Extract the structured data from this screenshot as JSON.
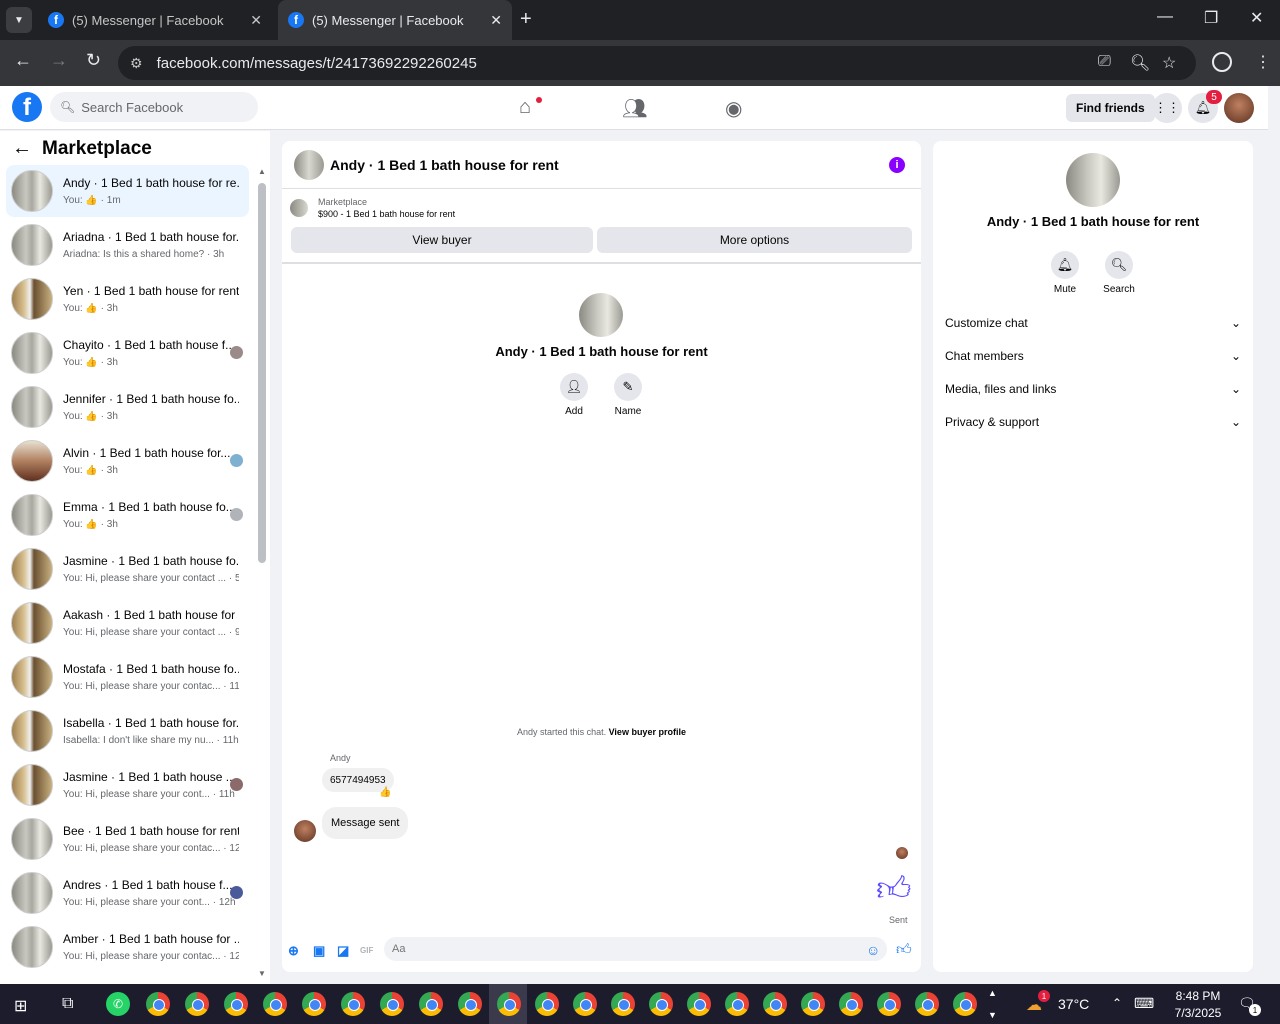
{
  "browser": {
    "tabs": [
      {
        "title": "(5) Messenger | Facebook",
        "active": false
      },
      {
        "title": "(5) Messenger | Facebook",
        "active": true
      }
    ],
    "url": "facebook.com/messages/t/24173692292260245"
  },
  "fb_nav": {
    "search_placeholder": "Search Facebook",
    "find_friends": "Find friends",
    "notification_count": "5"
  },
  "sidebar": {
    "title": "Marketplace",
    "conversations": [
      {
        "name": "Andy · 1 Bed 1 bath house for re...",
        "snippet": "You: 👍 · 1m"
      },
      {
        "name": "Ariadna · 1 Bed 1 bath house for...",
        "snippet": "Ariadna: Is this a shared home? · 3h"
      },
      {
        "name": "Yen · 1 Bed 1 bath house for rent",
        "snippet": "You: 👍 · 3h"
      },
      {
        "name": "Chayito · 1 Bed 1 bath house f...",
        "snippet": "You: 👍 · 3h"
      },
      {
        "name": "Jennifer · 1 Bed 1 bath house fo...",
        "snippet": "You: 👍 · 3h"
      },
      {
        "name": "Alvin · 1 Bed 1 bath house for...",
        "snippet": "You: 👍 · 3h"
      },
      {
        "name": "Emma · 1 Bed 1 bath house fo...",
        "snippet": "You: 👍 · 3h"
      },
      {
        "name": "Jasmine · 1 Bed 1 bath house fo...",
        "snippet": "You: Hi, please share your contact ... · 5h"
      },
      {
        "name": "Aakash · 1 Bed 1 bath house for ...",
        "snippet": "You: Hi, please share your contact ... · 9h"
      },
      {
        "name": "Mostafa · 1 Bed 1 bath house fo...",
        "snippet": "You: Hi, please share your contac... · 11h"
      },
      {
        "name": "Isabella · 1 Bed 1 bath house for...",
        "snippet": "Isabella: I don't like share my nu... · 11h"
      },
      {
        "name": "Jasmine · 1 Bed 1 bath house ...",
        "snippet": "You: Hi, please share your cont... · 11h"
      },
      {
        "name": "Bee · 1 Bed 1 bath house for rent",
        "snippet": "You: Hi, please share your contac... · 12h"
      },
      {
        "name": "Andres · 1 Bed 1 bath house f...",
        "snippet": "You: Hi, please share your cont... · 12h"
      },
      {
        "name": "Amber · 1 Bed 1 bath house for ...",
        "snippet": "You: Hi, please share your contac... · 12h"
      }
    ]
  },
  "chat": {
    "title": "Andy · 1 Bed 1 bath house for rent",
    "listing_category": "Marketplace",
    "listing_price": "$900 - 1 Bed 1 bath house for rent",
    "view_buyer": "View buyer",
    "more_options": "More options",
    "intro_title": "Andy · 1 Bed 1 bath house for rent",
    "add_label": "Add",
    "name_label": "Name",
    "started_text": "Andy started this chat.",
    "view_profile": "View buyer profile",
    "sender": "Andy",
    "message1": "6577494953",
    "message2": "Message sent",
    "sent_label": "Sent",
    "input_placeholder": "Aa",
    "gif_label": "GIF"
  },
  "right_panel": {
    "title": "Andy · 1 Bed 1 bath house for rent",
    "mute_label": "Mute",
    "search_label": "Search",
    "sections": [
      "Customize chat",
      "Chat members",
      "Media, files and links",
      "Privacy & support"
    ]
  },
  "taskbar": {
    "temperature": "37°C",
    "time": "8:48 PM",
    "date": "7/3/2025",
    "weather_badge": "1",
    "notification_count": "1"
  },
  "colors": {
    "fb_blue": "#1877f2",
    "messenger_purple": "#8a00ff",
    "thumb_color": "#5b4dff",
    "badge_red": "#e41e3f"
  }
}
